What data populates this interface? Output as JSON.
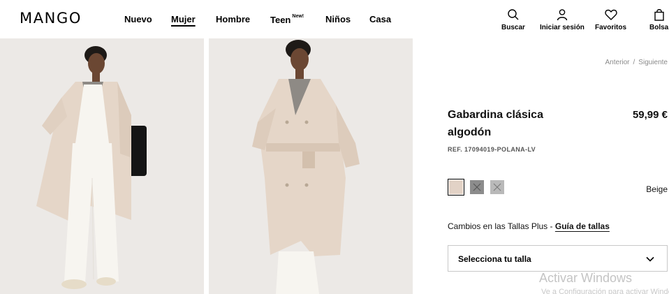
{
  "brand": "MANGO",
  "nav": {
    "items": [
      {
        "label": "Nuevo"
      },
      {
        "label": "Mujer",
        "active": true
      },
      {
        "label": "Hombre"
      },
      {
        "label": "Teen",
        "badge": "New!"
      },
      {
        "label": "Niños"
      },
      {
        "label": "Casa"
      }
    ]
  },
  "actions": {
    "search": "Buscar",
    "login": "Iniciar sesión",
    "favorites": "Favoritos",
    "bag": "Bolsa"
  },
  "pager": {
    "prev": "Anterior",
    "separator": "/",
    "next": "Siguiente"
  },
  "product": {
    "title_line1": "Gabardina clásica",
    "title_line2": "algodón",
    "price": "59,99 €",
    "ref": "REF. 17094019-POLANA-LV",
    "color_name": "Beige",
    "swatches": [
      {
        "color": "#e2d2c6",
        "selected": true
      },
      {
        "color": "#8c8c8c",
        "selected": false
      },
      {
        "color": "#b9b9b9",
        "selected": false
      }
    ],
    "size_note": "Cambios en las Tallas Plus -",
    "size_guide": "Guía de tallas",
    "size_select": "Selecciona tu talla"
  },
  "watermark": {
    "line1": "Activar Windows",
    "line2": "Ve a Configuración para activar Windows."
  },
  "colors": {
    "background": "#ffffff",
    "photo_bg": "#ece9e6",
    "coat": "#e5d6c8",
    "pants": "#f7f5f0"
  }
}
